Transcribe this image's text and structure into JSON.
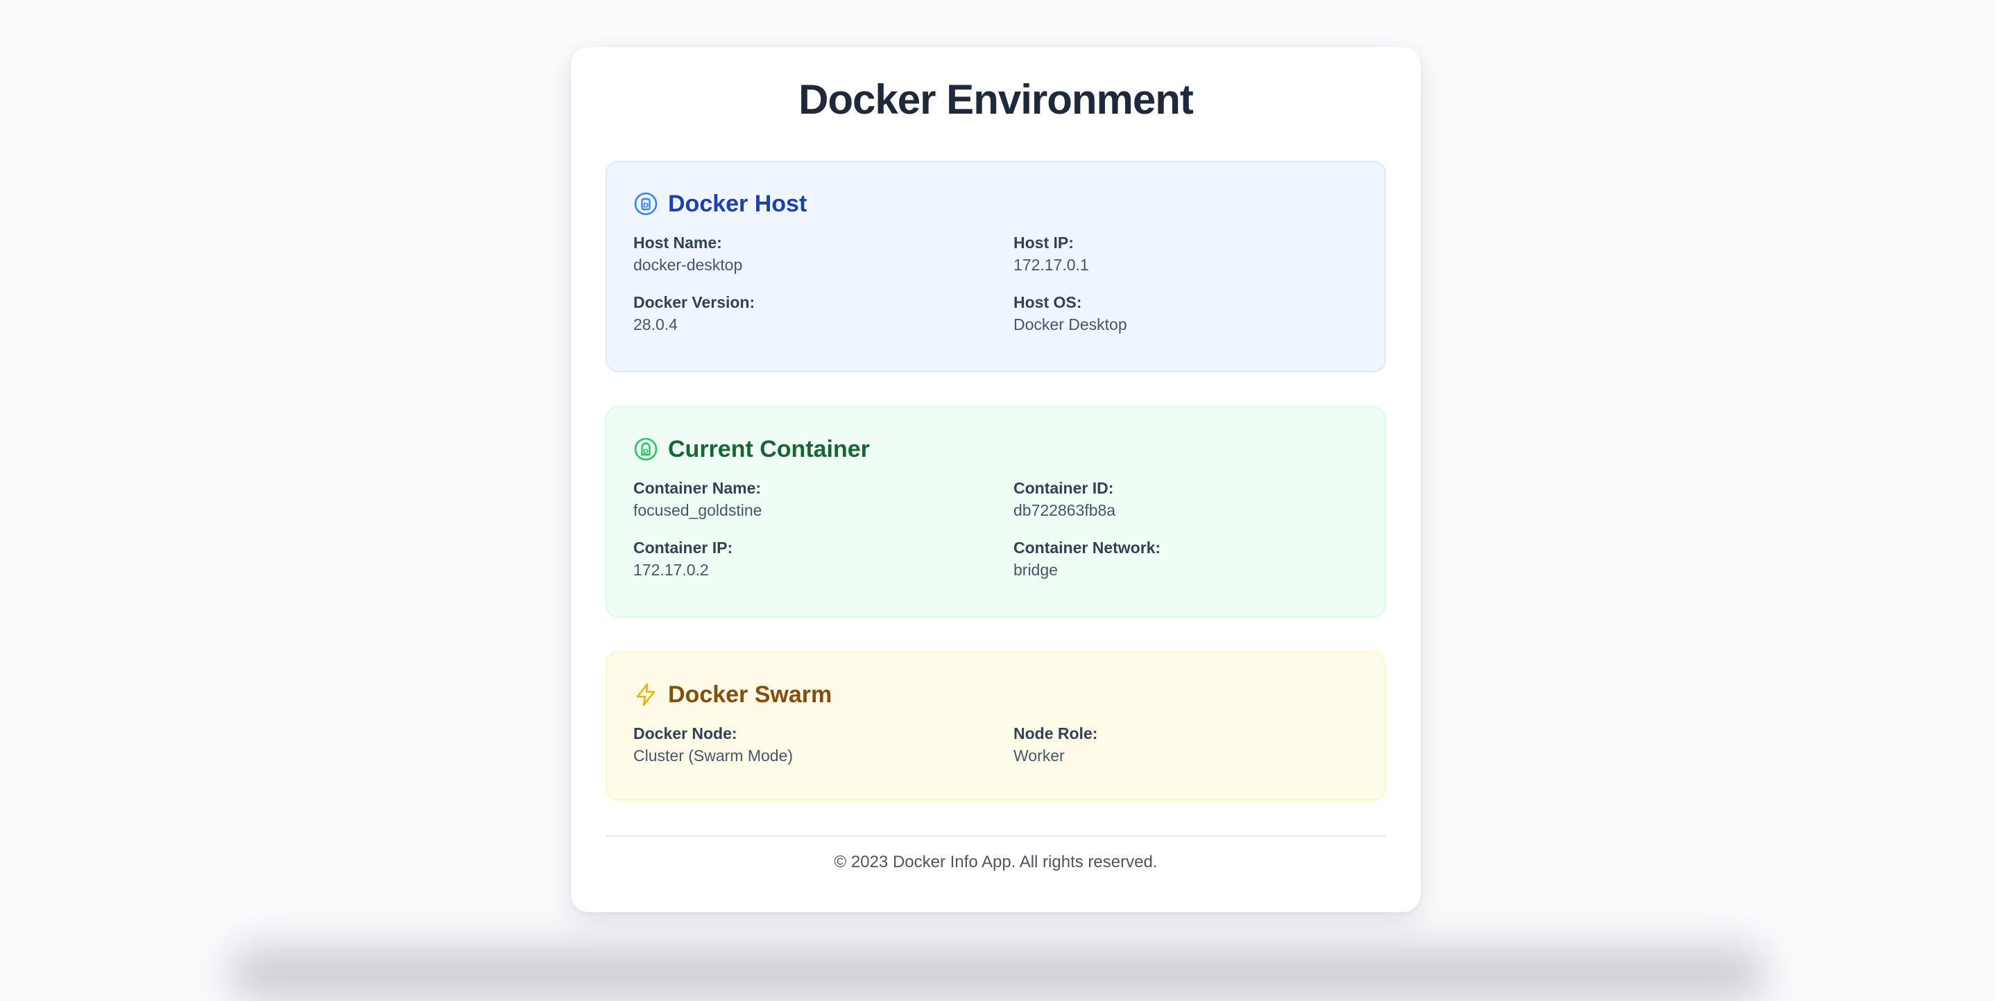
{
  "page": {
    "title": "Docker Environment"
  },
  "sections": {
    "host": {
      "title": "Docker Host",
      "icon": "docker-host-icon",
      "accent": "#1e40af",
      "fields": [
        {
          "label": "Host Name:",
          "value": "docker-desktop"
        },
        {
          "label": "Host IP:",
          "value": "172.17.0.1"
        },
        {
          "label": "Docker Version:",
          "value": "28.0.4"
        },
        {
          "label": "Host OS:",
          "value": "Docker Desktop"
        }
      ]
    },
    "container": {
      "title": "Current Container",
      "icon": "container-icon",
      "accent": "#166534",
      "fields": [
        {
          "label": "Container Name:",
          "value": "focused_goldstine"
        },
        {
          "label": "Container ID:",
          "value": "db722863fb8a"
        },
        {
          "label": "Container IP:",
          "value": "172.17.0.2"
        },
        {
          "label": "Container Network:",
          "value": "bridge"
        }
      ]
    },
    "swarm": {
      "title": "Docker Swarm",
      "icon": "lightning-icon",
      "accent": "#854d0e",
      "fields": [
        {
          "label": "Docker Node:",
          "value": "Cluster (Swarm Mode)"
        },
        {
          "label": "Node Role:",
          "value": "Worker"
        }
      ]
    }
  },
  "footer": {
    "text": "© 2023 Docker Info App. All rights reserved."
  }
}
